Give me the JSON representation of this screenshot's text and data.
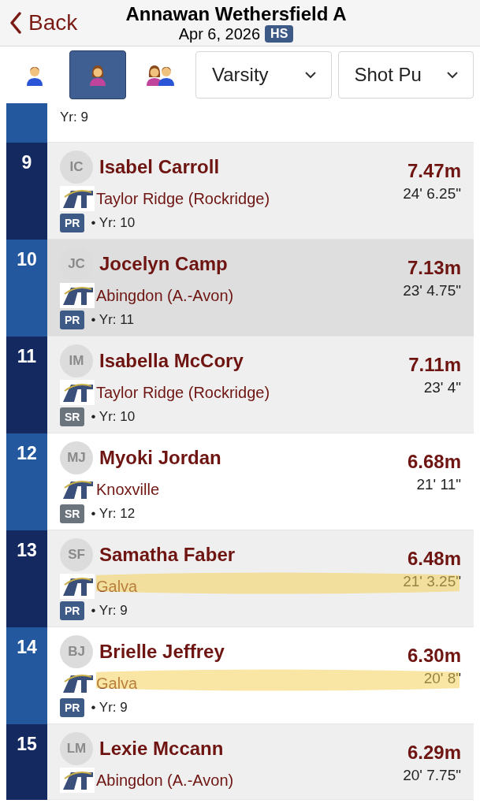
{
  "header": {
    "back": "Back",
    "title": "Annawan Wethersfield A",
    "date": "Apr 6, 2026",
    "level_badge": "HS"
  },
  "filters": {
    "genders": [
      {
        "kind": "boy",
        "selected": false
      },
      {
        "kind": "girl",
        "selected": true
      },
      {
        "kind": "both",
        "selected": false
      }
    ],
    "dropdowns": [
      "Varsity",
      "Shot Pu"
    ]
  },
  "partial_row": {
    "year": "Yr: 9"
  },
  "rows": [
    {
      "rank": "9",
      "initials": "IC",
      "name": "Isabel Carroll",
      "school": "Taylor Ridge (Rockridge)",
      "badge": {
        "text": "PR",
        "color": "#3e5a86"
      },
      "year": "• Yr: 10",
      "mark": "7.47m",
      "imperial": "24' 6.25\"",
      "highlighted": false,
      "marked": false
    },
    {
      "rank": "10",
      "initials": "JC",
      "name": "Jocelyn Camp",
      "school": "Abingdon (A.-Avon)",
      "badge": {
        "text": "PR",
        "color": "#3e5a86"
      },
      "year": "• Yr: 11",
      "mark": "7.13m",
      "imperial": "23' 4.75\"",
      "highlighted": true,
      "marked": false
    },
    {
      "rank": "11",
      "initials": "IM",
      "name": "Isabella McCory",
      "school": "Taylor Ridge (Rockridge)",
      "badge": {
        "text": "SR",
        "color": "#6b747d"
      },
      "year": "• Yr: 10",
      "mark": "7.11m",
      "imperial": "23' 4\"",
      "highlighted": false,
      "marked": false
    },
    {
      "rank": "12",
      "initials": "MJ",
      "name": "Myoki Jordan",
      "school": "Knoxville",
      "badge": {
        "text": "SR",
        "color": "#6b747d"
      },
      "year": "• Yr: 12",
      "mark": "6.68m",
      "imperial": "21' 11\"",
      "highlighted": false,
      "marked": false
    },
    {
      "rank": "13",
      "initials": "SF",
      "name": "Samatha Faber",
      "school": "Galva",
      "badge": {
        "text": "PR",
        "color": "#3e5a86"
      },
      "year": "• Yr: 9",
      "mark": "6.48m",
      "imperial": "21' 3.25\"",
      "highlighted": false,
      "marked": true
    },
    {
      "rank": "14",
      "initials": "BJ",
      "name": "Brielle Jeffrey",
      "school": "Galva",
      "badge": {
        "text": "PR",
        "color": "#3e5a86"
      },
      "year": "• Yr: 9",
      "mark": "6.30m",
      "imperial": "20' 8\"",
      "highlighted": false,
      "marked": true
    },
    {
      "rank": "15",
      "initials": "LM",
      "name": "Lexie Mccann",
      "school": "Abingdon (A.-Avon)",
      "mark": "6.29m",
      "imperial": "20' 7.75\"",
      "highlighted": false,
      "marked": false
    }
  ]
}
